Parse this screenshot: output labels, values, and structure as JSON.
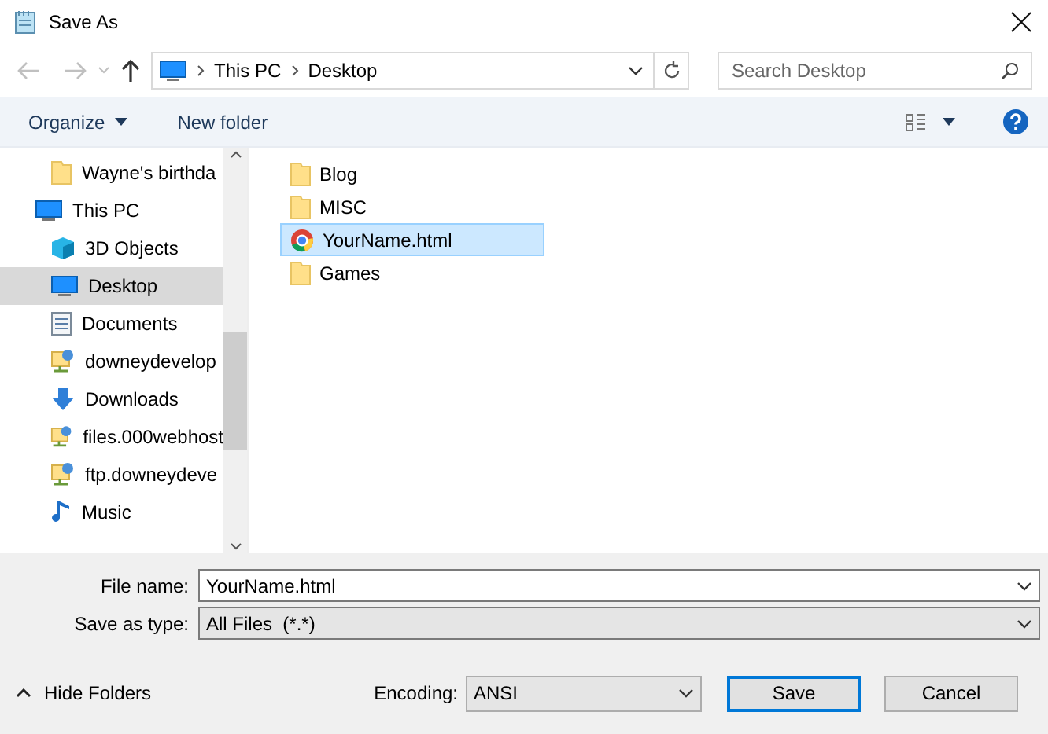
{
  "window": {
    "title": "Save As"
  },
  "nav": {
    "back": {
      "disabled": true
    },
    "forward": {
      "disabled": true
    },
    "up": {
      "disabled": false
    },
    "breadcrumbs": [
      "This PC",
      "Desktop"
    ],
    "search": {
      "placeholder": "Search Desktop"
    }
  },
  "toolbar": {
    "organize": "Organize",
    "new_folder": "New folder"
  },
  "sidebar": {
    "continued_items": [
      {
        "label": "Wayne's birthda",
        "kind": "folder",
        "selected": false
      }
    ],
    "items": [
      {
        "label": "This PC",
        "kind": "pc",
        "selected": false,
        "children": [
          {
            "label": "3D Objects",
            "kind": "cube",
            "selected": false
          },
          {
            "label": "Desktop",
            "kind": "desktop",
            "selected": true
          },
          {
            "label": "Documents",
            "kind": "document",
            "selected": false
          },
          {
            "label": "downeydevelop",
            "kind": "network",
            "selected": false
          },
          {
            "label": "Downloads",
            "kind": "download",
            "selected": false
          },
          {
            "label": "files.000webhost",
            "kind": "network",
            "selected": false
          },
          {
            "label": "ftp.downeydeve",
            "kind": "network",
            "selected": false
          },
          {
            "label": "Music",
            "kind": "music",
            "selected": false
          }
        ]
      }
    ]
  },
  "files": [
    {
      "name": "Blog",
      "kind": "folder",
      "selected": false
    },
    {
      "name": "MISC",
      "kind": "folder",
      "selected": false
    },
    {
      "name": "YourName.html",
      "kind": "html",
      "selected": true
    },
    {
      "name": "Games",
      "kind": "folder",
      "selected": false
    }
  ],
  "form": {
    "file_name": {
      "label": "File name:",
      "value": "YourName.html"
    },
    "save_as_type": {
      "label": "Save as type:",
      "value": "All Files  (*.*)"
    }
  },
  "footer": {
    "hide_folders": "Hide Folders",
    "encoding": {
      "label": "Encoding:",
      "value": "ANSI"
    },
    "buttons": [
      {
        "label": "Save",
        "default": true
      },
      {
        "label": "Cancel",
        "default": false
      }
    ]
  }
}
